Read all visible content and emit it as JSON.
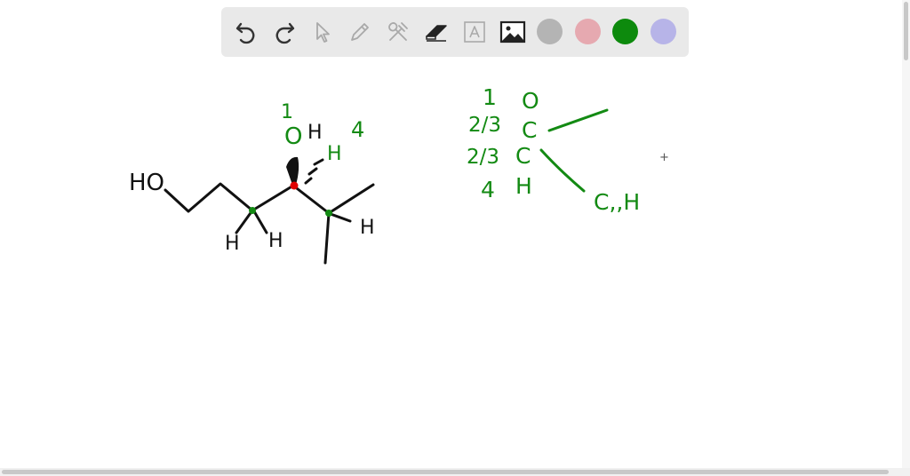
{
  "toolbar": {
    "tools": [
      {
        "name": "undo-icon",
        "enabled": true
      },
      {
        "name": "redo-icon",
        "enabled": true
      },
      {
        "name": "select-pointer-icon",
        "enabled": false
      },
      {
        "name": "pencil-icon",
        "enabled": false
      },
      {
        "name": "tools-icon",
        "enabled": false
      },
      {
        "name": "eraser-icon",
        "enabled": true
      },
      {
        "name": "text-icon",
        "enabled": false
      },
      {
        "name": "image-icon",
        "enabled": true
      }
    ],
    "colors": [
      {
        "name": "gray",
        "hex": "#b4b4b4"
      },
      {
        "name": "pink",
        "hex": "#e6a9b0"
      },
      {
        "name": "green",
        "hex": "#0d8a0d"
      },
      {
        "name": "lavender",
        "hex": "#b7b4e8"
      }
    ]
  },
  "drawing": {
    "ink_black": "#111111",
    "ink_green": "#138a13",
    "ink_red": "#e00000",
    "black_labels": {
      "ho": "HO",
      "h_left1": "H",
      "h_left2": "H",
      "oh_h": "H",
      "h_right": "H"
    },
    "green_labels": {
      "num_one": "1",
      "o_top": "O",
      "num_four": "4",
      "h_green": "H"
    },
    "priority_table": [
      {
        "rank": "1",
        "atom": "O"
      },
      {
        "rank": "2/3",
        "atom": "C"
      },
      {
        "rank": "2/3",
        "atom": "C"
      },
      {
        "rank": "4",
        "atom": "H"
      }
    ],
    "substituent": "C,,H",
    "cursor": "+"
  }
}
